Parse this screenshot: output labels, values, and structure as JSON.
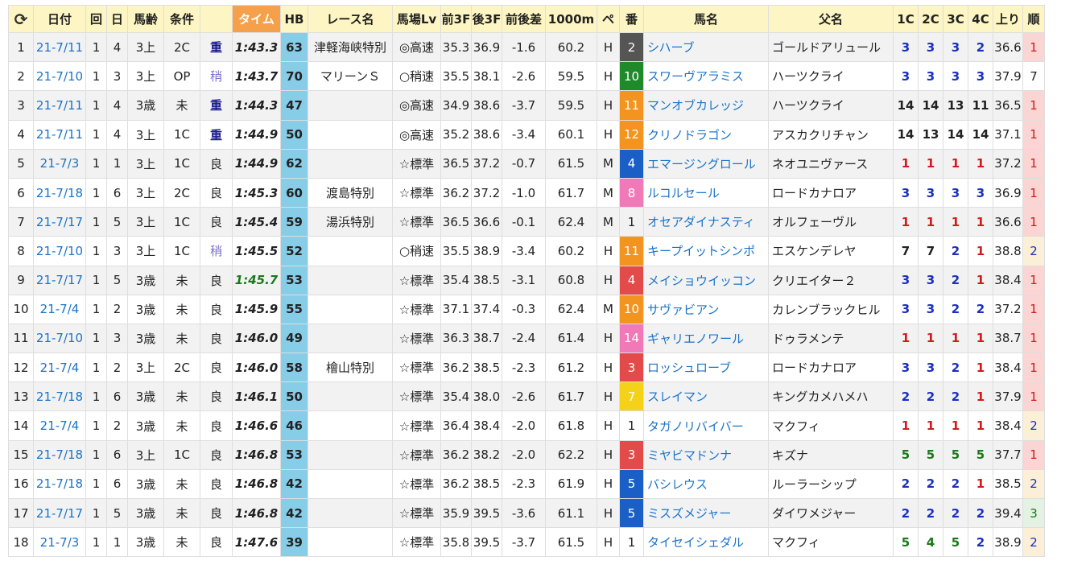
{
  "headers": {
    "reload": "C",
    "date": "日付",
    "kai": "回",
    "nichi": "日",
    "age": "馬齢",
    "class": "条件",
    "going": "",
    "time": "タイム",
    "hb": "HB",
    "race": "レース名",
    "track_lv": "馬場Lv",
    "f3": "前3F",
    "l3": "後3F",
    "diff": "前後差",
    "m1000": "1000m",
    "pace": "ペ",
    "num": "番",
    "horse": "馬名",
    "sire": "父名",
    "c1": "1C",
    "c2": "2C",
    "c3": "3C",
    "c4": "4C",
    "last": "上り",
    "rank": "順"
  },
  "colors": {
    "header_bg": "#fdf6c4",
    "time_header_bg": "#f5a04a",
    "hb_bg": "#87cde8",
    "link": "#1a73c9"
  },
  "rows": [
    {
      "idx": "1",
      "date": "21-7/11",
      "kai": "1",
      "nichi": "4",
      "age": "3上",
      "class": "2C",
      "going": "重",
      "time": "1:43.3",
      "hb": "63",
      "race": "津軽海峡特別",
      "track": "◎高速",
      "f3": "35.3",
      "l3": "36.9",
      "diff": "-1.6",
      "m1000": "60.2",
      "pace": "H",
      "num": "2",
      "numColor": "#555555",
      "horse": "シハーブ",
      "sire": "ゴールドアリュール",
      "c1": "3",
      "c2": "3",
      "c3": "3",
      "c4": "2",
      "last": "36.6",
      "rank": "1"
    },
    {
      "idx": "2",
      "date": "21-7/10",
      "kai": "1",
      "nichi": "3",
      "age": "3上",
      "class": "OP",
      "going": "稍",
      "time": "1:43.7",
      "hb": "70",
      "race": "マリーンＳ",
      "track": "○稍速",
      "f3": "35.5",
      "l3": "38.1",
      "diff": "-2.6",
      "m1000": "59.5",
      "pace": "H",
      "num": "10",
      "numColor": "#1e8a2a",
      "horse": "スワーヴアラミス",
      "sire": "ハーツクライ",
      "c1": "3",
      "c2": "3",
      "c3": "3",
      "c4": "3",
      "last": "37.9",
      "rank": "7"
    },
    {
      "idx": "3",
      "date": "21-7/11",
      "kai": "1",
      "nichi": "4",
      "age": "3歳",
      "class": "未",
      "going": "重",
      "time": "1:44.3",
      "hb": "47",
      "race": "",
      "track": "◎高速",
      "f3": "34.9",
      "l3": "38.6",
      "diff": "-3.7",
      "m1000": "59.5",
      "pace": "H",
      "num": "11",
      "numColor": "#f39420",
      "horse": "マンオブカレッジ",
      "sire": "ハーツクライ",
      "c1": "14",
      "c2": "14",
      "c3": "13",
      "c4": "11",
      "last": "36.5",
      "rank": "1"
    },
    {
      "idx": "4",
      "date": "21-7/11",
      "kai": "1",
      "nichi": "4",
      "age": "3上",
      "class": "1C",
      "going": "重",
      "time": "1:44.9",
      "hb": "50",
      "race": "",
      "track": "◎高速",
      "f3": "35.2",
      "l3": "38.6",
      "diff": "-3.4",
      "m1000": "60.1",
      "pace": "H",
      "num": "12",
      "numColor": "#f39420",
      "horse": "クリノドラゴン",
      "sire": "アスカクリチャン",
      "c1": "14",
      "c2": "13",
      "c3": "14",
      "c4": "14",
      "last": "37.1",
      "rank": "1"
    },
    {
      "idx": "5",
      "date": "21-7/3",
      "kai": "1",
      "nichi": "1",
      "age": "3上",
      "class": "1C",
      "going": "良",
      "time": "1:44.9",
      "hb": "62",
      "race": "",
      "track": "☆標準",
      "f3": "36.5",
      "l3": "37.2",
      "diff": "-0.7",
      "m1000": "61.5",
      "pace": "M",
      "num": "4",
      "numColor": "#1a5fc6",
      "horse": "エマージングロール",
      "sire": "ネオユニヴァース",
      "c1": "1",
      "c2": "1",
      "c3": "1",
      "c4": "1",
      "last": "37.2",
      "rank": "1"
    },
    {
      "idx": "6",
      "date": "21-7/18",
      "kai": "1",
      "nichi": "6",
      "age": "3上",
      "class": "2C",
      "going": "良",
      "time": "1:45.3",
      "hb": "60",
      "race": "渡島特別",
      "track": "☆標準",
      "f3": "36.2",
      "l3": "37.2",
      "diff": "-1.0",
      "m1000": "61.7",
      "pace": "M",
      "num": "8",
      "numColor": "#f07ab8",
      "horse": "ルコルセール",
      "sire": "ロードカナロア",
      "c1": "3",
      "c2": "3",
      "c3": "3",
      "c4": "3",
      "last": "36.9",
      "rank": "1"
    },
    {
      "idx": "7",
      "date": "21-7/17",
      "kai": "1",
      "nichi": "5",
      "age": "3上",
      "class": "1C",
      "going": "良",
      "time": "1:45.4",
      "hb": "59",
      "race": "湯浜特別",
      "track": "☆標準",
      "f3": "36.5",
      "l3": "36.6",
      "diff": "-0.1",
      "m1000": "62.4",
      "pace": "M",
      "num": "1",
      "numColor": "",
      "horse": "オセアダイナスティ",
      "sire": "オルフェーヴル",
      "c1": "1",
      "c2": "1",
      "c3": "1",
      "c4": "1",
      "last": "36.6",
      "rank": "1"
    },
    {
      "idx": "8",
      "date": "21-7/10",
      "kai": "1",
      "nichi": "3",
      "age": "3上",
      "class": "1C",
      "going": "稍",
      "time": "1:45.5",
      "hb": "52",
      "race": "",
      "track": "○稍速",
      "f3": "35.5",
      "l3": "38.9",
      "diff": "-3.4",
      "m1000": "60.2",
      "pace": "H",
      "num": "11",
      "numColor": "#f39420",
      "horse": "キープイットシンポ",
      "sire": "エスケンデレヤ",
      "c1": "7",
      "c2": "7",
      "c3": "2",
      "c4": "1",
      "last": "38.8",
      "rank": "2"
    },
    {
      "idx": "9",
      "date": "21-7/17",
      "kai": "1",
      "nichi": "5",
      "age": "3歳",
      "class": "未",
      "going": "良",
      "time": "1:45.7",
      "hb": "53",
      "race": "",
      "track": "☆標準",
      "f3": "35.4",
      "l3": "38.5",
      "diff": "-3.1",
      "m1000": "60.8",
      "pace": "H",
      "num": "4",
      "numColor": "#e34a4a",
      "horse": "メイショウイッコン",
      "sire": "クリエイター２",
      "c1": "3",
      "c2": "3",
      "c3": "2",
      "c4": "1",
      "last": "38.4",
      "rank": "1"
    },
    {
      "idx": "10",
      "date": "21-7/4",
      "kai": "1",
      "nichi": "2",
      "age": "3歳",
      "class": "未",
      "going": "良",
      "time": "1:45.9",
      "hb": "55",
      "race": "",
      "track": "☆標準",
      "f3": "37.1",
      "l3": "37.4",
      "diff": "-0.3",
      "m1000": "62.4",
      "pace": "M",
      "num": "10",
      "numColor": "#f39420",
      "horse": "サヴァビアン",
      "sire": "カレンブラックヒル",
      "c1": "3",
      "c2": "3",
      "c3": "2",
      "c4": "2",
      "last": "37.2",
      "rank": "1"
    },
    {
      "idx": "11",
      "date": "21-7/10",
      "kai": "1",
      "nichi": "3",
      "age": "3歳",
      "class": "未",
      "going": "良",
      "time": "1:46.0",
      "hb": "49",
      "race": "",
      "track": "☆標準",
      "f3": "36.3",
      "l3": "38.7",
      "diff": "-2.4",
      "m1000": "61.4",
      "pace": "H",
      "num": "14",
      "numColor": "#f07ab8",
      "horse": "ギャリエノワール",
      "sire": "ドゥラメンテ",
      "c1": "1",
      "c2": "1",
      "c3": "1",
      "c4": "1",
      "last": "38.7",
      "rank": "1"
    },
    {
      "idx": "12",
      "date": "21-7/4",
      "kai": "1",
      "nichi": "2",
      "age": "3上",
      "class": "2C",
      "going": "良",
      "time": "1:46.0",
      "hb": "58",
      "race": "檜山特別",
      "track": "☆標準",
      "f3": "36.2",
      "l3": "38.5",
      "diff": "-2.3",
      "m1000": "61.2",
      "pace": "H",
      "num": "3",
      "numColor": "#e34a4a",
      "horse": "ロッシュローブ",
      "sire": "ロードカナロア",
      "c1": "3",
      "c2": "3",
      "c3": "2",
      "c4": "1",
      "last": "38.4",
      "rank": "1"
    },
    {
      "idx": "13",
      "date": "21-7/18",
      "kai": "1",
      "nichi": "6",
      "age": "3歳",
      "class": "未",
      "going": "良",
      "time": "1:46.1",
      "hb": "50",
      "race": "",
      "track": "☆標準",
      "f3": "35.4",
      "l3": "38.0",
      "diff": "-2.6",
      "m1000": "61.7",
      "pace": "H",
      "num": "7",
      "numColor": "#f5d21a",
      "horse": "スレイマン",
      "sire": "キングカメハメハ",
      "c1": "2",
      "c2": "2",
      "c3": "2",
      "c4": "1",
      "last": "37.9",
      "rank": "1"
    },
    {
      "idx": "14",
      "date": "21-7/4",
      "kai": "1",
      "nichi": "2",
      "age": "3歳",
      "class": "未",
      "going": "良",
      "time": "1:46.6",
      "hb": "46",
      "race": "",
      "track": "☆標準",
      "f3": "36.4",
      "l3": "38.4",
      "diff": "-2.0",
      "m1000": "61.8",
      "pace": "H",
      "num": "1",
      "numColor": "",
      "horse": "タガノリバイバー",
      "sire": "マクフィ",
      "c1": "1",
      "c2": "1",
      "c3": "1",
      "c4": "1",
      "last": "38.4",
      "rank": "2"
    },
    {
      "idx": "15",
      "date": "21-7/18",
      "kai": "1",
      "nichi": "6",
      "age": "3上",
      "class": "1C",
      "going": "良",
      "time": "1:46.8",
      "hb": "53",
      "race": "",
      "track": "☆標準",
      "f3": "36.2",
      "l3": "38.2",
      "diff": "-2.0",
      "m1000": "62.2",
      "pace": "H",
      "num": "3",
      "numColor": "#e34a4a",
      "horse": "ミヤビマドンナ",
      "sire": "キズナ",
      "c1": "5",
      "c2": "5",
      "c3": "5",
      "c4": "5",
      "last": "37.7",
      "rank": "1"
    },
    {
      "idx": "16",
      "date": "21-7/18",
      "kai": "1",
      "nichi": "6",
      "age": "3歳",
      "class": "未",
      "going": "良",
      "time": "1:46.8",
      "hb": "42",
      "race": "",
      "track": "☆標準",
      "f3": "36.2",
      "l3": "38.5",
      "diff": "-2.3",
      "m1000": "61.9",
      "pace": "H",
      "num": "5",
      "numColor": "#1a5fc6",
      "horse": "バシレウス",
      "sire": "ルーラーシップ",
      "c1": "2",
      "c2": "2",
      "c3": "2",
      "c4": "1",
      "last": "38.5",
      "rank": "2"
    },
    {
      "idx": "17",
      "date": "21-7/17",
      "kai": "1",
      "nichi": "5",
      "age": "3歳",
      "class": "未",
      "going": "良",
      "time": "1:46.8",
      "hb": "42",
      "race": "",
      "track": "☆標準",
      "f3": "35.9",
      "l3": "39.5",
      "diff": "-3.6",
      "m1000": "61.1",
      "pace": "H",
      "num": "5",
      "numColor": "#1a5fc6",
      "horse": "ミスズメジャー",
      "sire": "ダイワメジャー",
      "c1": "2",
      "c2": "2",
      "c3": "2",
      "c4": "2",
      "last": "39.4",
      "rank": "3"
    },
    {
      "idx": "18",
      "date": "21-7/3",
      "kai": "1",
      "nichi": "1",
      "age": "3歳",
      "class": "未",
      "going": "良",
      "time": "1:47.6",
      "hb": "39",
      "race": "",
      "track": "☆標準",
      "f3": "35.8",
      "l3": "39.5",
      "diff": "-3.7",
      "m1000": "61.5",
      "pace": "H",
      "num": "1",
      "numColor": "",
      "horse": "タイセイシェダル",
      "sire": "マクフィ",
      "c1": "5",
      "c2": "4",
      "c3": "5",
      "c4": "2",
      "last": "38.9",
      "rank": "2"
    }
  ]
}
